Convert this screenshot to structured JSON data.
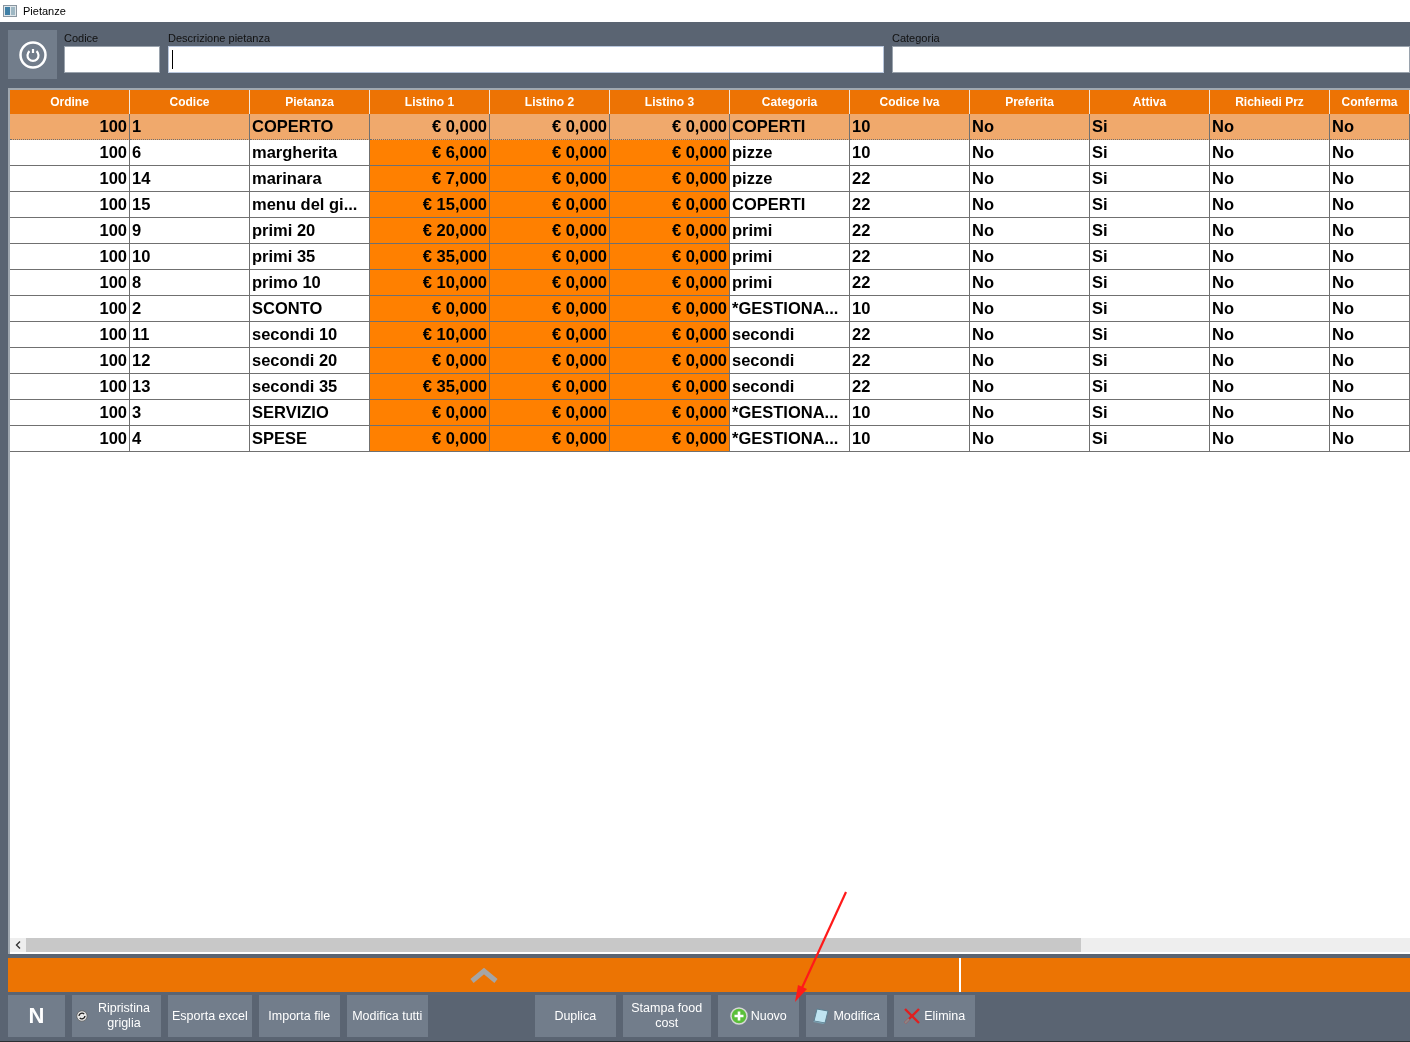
{
  "window": {
    "title": "Pietanze"
  },
  "filters": [
    {
      "label": "Codice",
      "focused": false
    },
    {
      "label": "Descrizione pietanza",
      "focused": true
    },
    {
      "label": "Categoria",
      "focused": false
    }
  ],
  "table": {
    "columns": [
      {
        "label": "Ordine",
        "kind": "number"
      },
      {
        "label": "Codice",
        "kind": "text"
      },
      {
        "label": "Pietanza",
        "kind": "text"
      },
      {
        "label": "Listino 1",
        "kind": "price"
      },
      {
        "label": "Listino 2",
        "kind": "price"
      },
      {
        "label": "Listino 3",
        "kind": "price"
      },
      {
        "label": "Categoria",
        "kind": "text"
      },
      {
        "label": "Codice Iva",
        "kind": "text"
      },
      {
        "label": "Preferita",
        "kind": "text"
      },
      {
        "label": "Attiva",
        "kind": "text"
      },
      {
        "label": "Richiedi Prz",
        "kind": "text"
      },
      {
        "label": "Conferma",
        "kind": "text"
      }
    ],
    "rows": [
      {
        "selected": true,
        "cells": [
          "100",
          "1",
          "COPERTO",
          "€ 0,000",
          "€ 0,000",
          "€ 0,000",
          "COPERTI",
          "10",
          "No",
          "Si",
          "No",
          "No"
        ]
      },
      {
        "selected": false,
        "cells": [
          "100",
          "6",
          "margherita",
          "€ 6,000",
          "€ 0,000",
          "€ 0,000",
          "pizze",
          "10",
          "No",
          "Si",
          "No",
          "No"
        ]
      },
      {
        "selected": false,
        "cells": [
          "100",
          "14",
          "marinara",
          "€ 7,000",
          "€ 0,000",
          "€ 0,000",
          "pizze",
          "22",
          "No",
          "Si",
          "No",
          "No"
        ]
      },
      {
        "selected": false,
        "cells": [
          "100",
          "15",
          "menu del gi...",
          "€ 15,000",
          "€ 0,000",
          "€ 0,000",
          "COPERTI",
          "22",
          "No",
          "Si",
          "No",
          "No"
        ]
      },
      {
        "selected": false,
        "cells": [
          "100",
          "9",
          "primi 20",
          "€ 20,000",
          "€ 0,000",
          "€ 0,000",
          "primi",
          "22",
          "No",
          "Si",
          "No",
          "No"
        ]
      },
      {
        "selected": false,
        "cells": [
          "100",
          "10",
          "primi 35",
          "€ 35,000",
          "€ 0,000",
          "€ 0,000",
          "primi",
          "22",
          "No",
          "Si",
          "No",
          "No"
        ]
      },
      {
        "selected": false,
        "cells": [
          "100",
          "8",
          "primo 10",
          "€ 10,000",
          "€ 0,000",
          "€ 0,000",
          "primi",
          "22",
          "No",
          "Si",
          "No",
          "No"
        ]
      },
      {
        "selected": false,
        "cells": [
          "100",
          "2",
          "SCONTO",
          "€ 0,000",
          "€ 0,000",
          "€ 0,000",
          "*GESTIONA...",
          "10",
          "No",
          "Si",
          "No",
          "No"
        ]
      },
      {
        "selected": false,
        "cells": [
          "100",
          "11",
          "secondi 10",
          "€ 10,000",
          "€ 0,000",
          "€ 0,000",
          "secondi",
          "22",
          "No",
          "Si",
          "No",
          "No"
        ]
      },
      {
        "selected": false,
        "cells": [
          "100",
          "12",
          "secondi 20",
          "€ 0,000",
          "€ 0,000",
          "€ 0,000",
          "secondi",
          "22",
          "No",
          "Si",
          "No",
          "No"
        ]
      },
      {
        "selected": false,
        "cells": [
          "100",
          "13",
          "secondi 35",
          "€ 35,000",
          "€ 0,000",
          "€ 0,000",
          "secondi",
          "22",
          "No",
          "Si",
          "No",
          "No"
        ]
      },
      {
        "selected": false,
        "cells": [
          "100",
          "3",
          "SERVIZIO",
          "€ 0,000",
          "€ 0,000",
          "€ 0,000",
          "*GESTIONA...",
          "10",
          "No",
          "Si",
          "No",
          "No"
        ]
      },
      {
        "selected": false,
        "cells": [
          "100",
          "4",
          "SPESE",
          "€ 0,000",
          "€ 0,000",
          "€ 0,000",
          "*GESTIONA...",
          "10",
          "No",
          "Si",
          "No",
          "No"
        ]
      }
    ]
  },
  "toolbar_left": [
    {
      "label": "N",
      "kind": "letter"
    },
    {
      "label": "Ripristina griglia",
      "kind": "refresh"
    },
    {
      "label": "Esporta excel",
      "kind": "plain"
    },
    {
      "label": "Importa file",
      "kind": "plain"
    },
    {
      "label": "Modifica tutti",
      "kind": "plain"
    }
  ],
  "toolbar_right": [
    {
      "label": "Duplica",
      "kind": "plain"
    },
    {
      "label": "Stampa food cost",
      "kind": "plain"
    },
    {
      "label": "Nuovo",
      "kind": "add"
    },
    {
      "label": "Modifica",
      "kind": "edit"
    },
    {
      "label": "Elimina",
      "kind": "delete"
    }
  ]
}
